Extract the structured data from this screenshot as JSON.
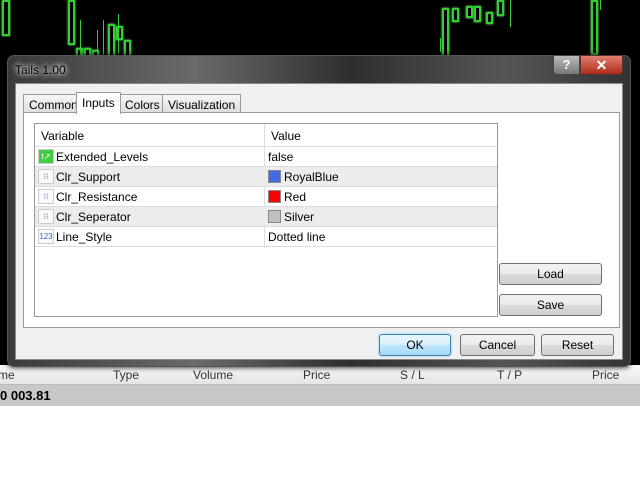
{
  "dialog": {
    "title": "Tails 1.00",
    "help_label": "?",
    "close_label": "✕",
    "tabs": [
      {
        "label": "Common"
      },
      {
        "label": "Inputs",
        "active": true
      },
      {
        "label": "Colors"
      },
      {
        "label": "Visualization"
      }
    ],
    "grid": {
      "headers": {
        "variable": "Variable",
        "value": "Value"
      },
      "rows": [
        {
          "variable": "Extended_Levels",
          "value": "false",
          "icon": "bool-icon",
          "icon_text": "t↗"
        },
        {
          "variable": "Clr_Support",
          "value": "RoyalBlue",
          "icon": "color-icon",
          "icon_text": "⁝⁝",
          "swatch": "#4169E1"
        },
        {
          "variable": "Clr_Resistance",
          "value": "Red",
          "icon": "color-icon",
          "icon_text": "⁝⁝",
          "swatch": "#FF0000"
        },
        {
          "variable": "Clr_Seperator",
          "value": "Silver",
          "icon": "color-icon",
          "icon_text": "⁝⁝",
          "swatch": "#C0C0C0"
        },
        {
          "variable": "Line_Style",
          "value": "Dotted line",
          "icon": "number-icon",
          "icon_text": "123"
        }
      ]
    },
    "buttons": {
      "load": "Load",
      "save": "Save",
      "ok": "OK",
      "cancel": "Cancel",
      "reset": "Reset"
    }
  },
  "terminal": {
    "columns": [
      "me",
      "Type",
      "Volume",
      "Price",
      "S / L",
      "T / P",
      "Price"
    ],
    "balance_row": "0 003.81"
  }
}
